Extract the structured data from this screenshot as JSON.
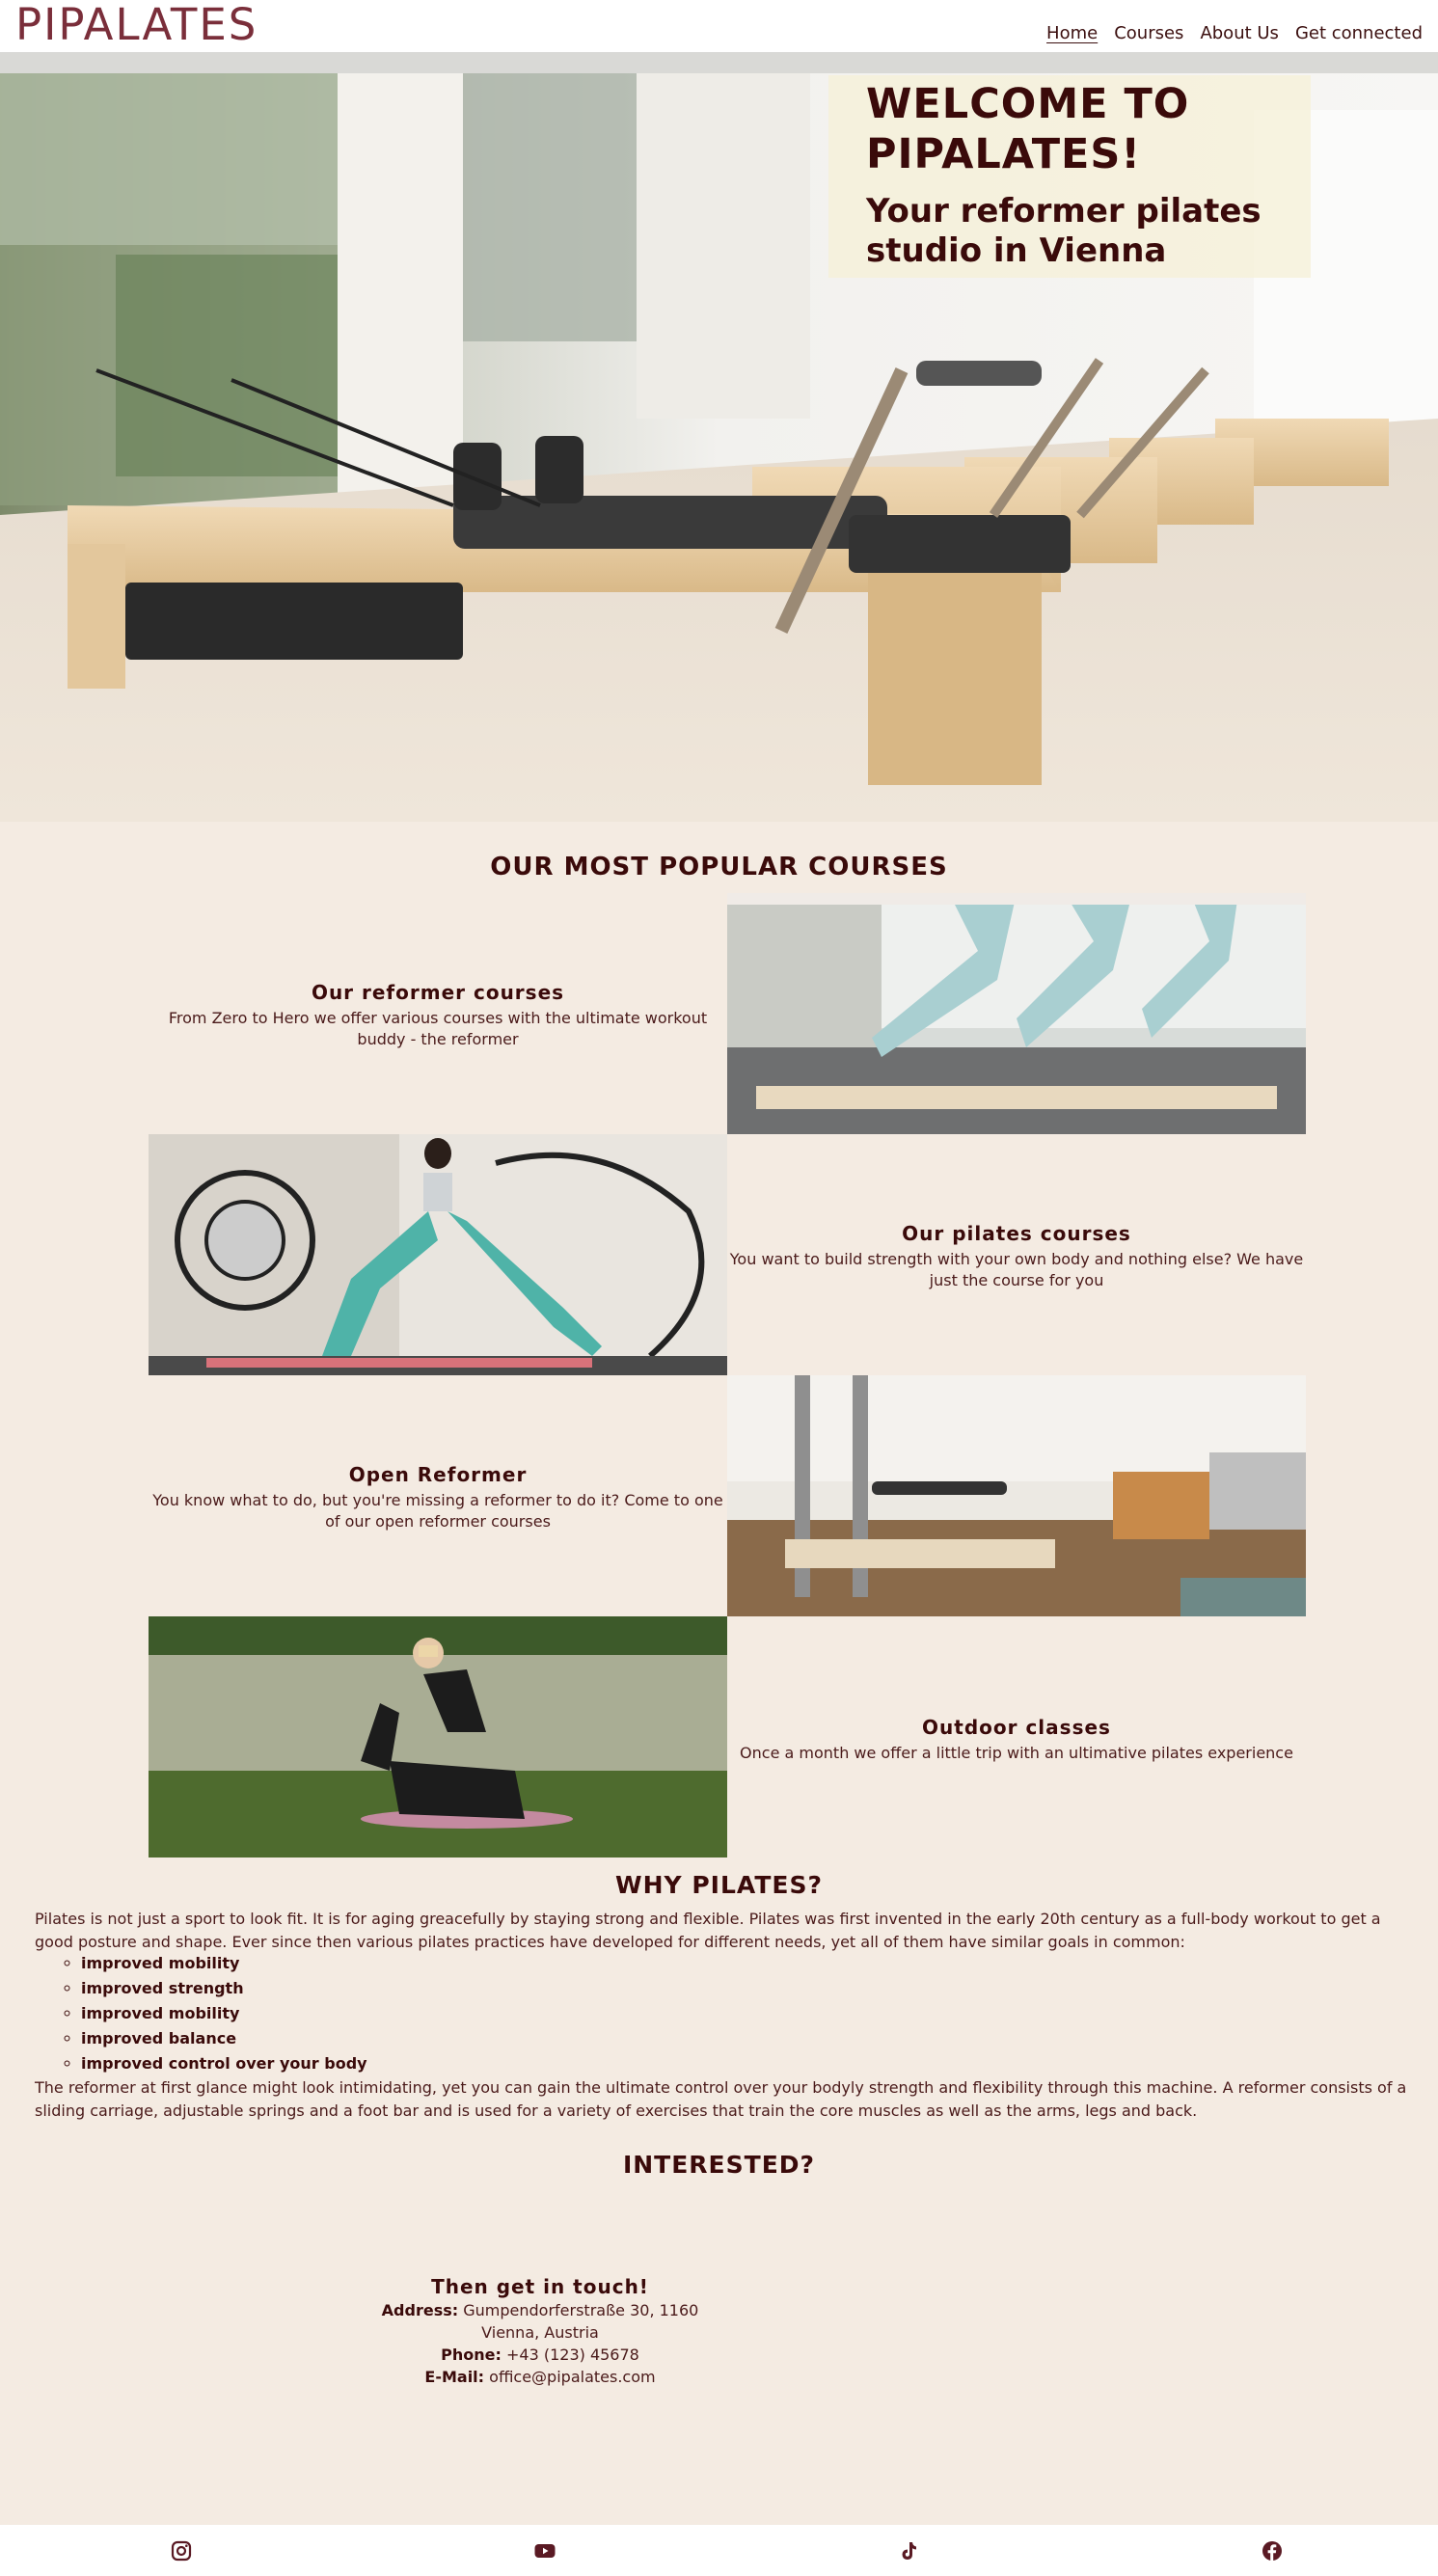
{
  "header": {
    "logo": "PIPALATES",
    "nav": [
      "Home",
      "Courses",
      "About Us",
      "Get connected"
    ]
  },
  "hero": {
    "title_line1": "WELCOME TO",
    "title_line2": "PIPALATES!",
    "subtitle_line1": "Your reformer pilates",
    "subtitle_line2": "studio in Vienna"
  },
  "courses": {
    "heading": "OUR MOST POPULAR COURSES",
    "items": [
      {
        "title": "Our reformer courses",
        "text": "From Zero to Hero we offer various courses with the ultimate workout buddy - the reformer"
      },
      {
        "title": "Our pilates courses",
        "text": "You want to build strength with your own body and nothing else? We have just the course for you"
      },
      {
        "title": "Open Reformer",
        "text": "You know what to do, but you're missing a reformer to do it? Come to one of our open reformer courses"
      },
      {
        "title": "Outdoor classes",
        "text": "Once a month we offer a little trip with an ultimative pilates experience"
      }
    ]
  },
  "why": {
    "heading": "WHY PILATES?",
    "intro": "Pilates is not just a sport to look fit. It is for aging greacefully by staying strong and flexible. Pilates was first invented in the early 20th century as a full-body workout to get a good posture and shape. Ever since then various pilates practices have developed for different needs, yet all of them have similar goals in common:",
    "list": [
      "improved mobility",
      "improved strength",
      "improved mobility",
      "improved balance",
      "improved control over your body"
    ],
    "outro": "The reformer at first glance might look intimidating, yet you can gain the ultimate control over your bodyly strength and flexibility through this machine. A reformer consists of a sliding carriage, adjustable springs and a foot bar and is used for a variety of exercises that train the core muscles as well as the arms, legs and back."
  },
  "contact": {
    "heading": "INTERESTED?",
    "subheading": "Then get in touch!",
    "address_label": "Address:",
    "address_line1": "Gumpendorferstraße 30, 1160",
    "address_line2": "Vienna, Austria",
    "phone_label": "Phone:",
    "phone": "+43 (123) 45678",
    "email_label": "E-Mail:",
    "email": "office@pipalates.com"
  },
  "footer": {
    "icons": [
      "instagram-icon",
      "youtube-icon",
      "tiktok-icon",
      "facebook-icon"
    ]
  },
  "colors": {
    "background": "#f4ebe2",
    "brand": "#7a2e3a",
    "text_dark": "#3a0a0a"
  }
}
